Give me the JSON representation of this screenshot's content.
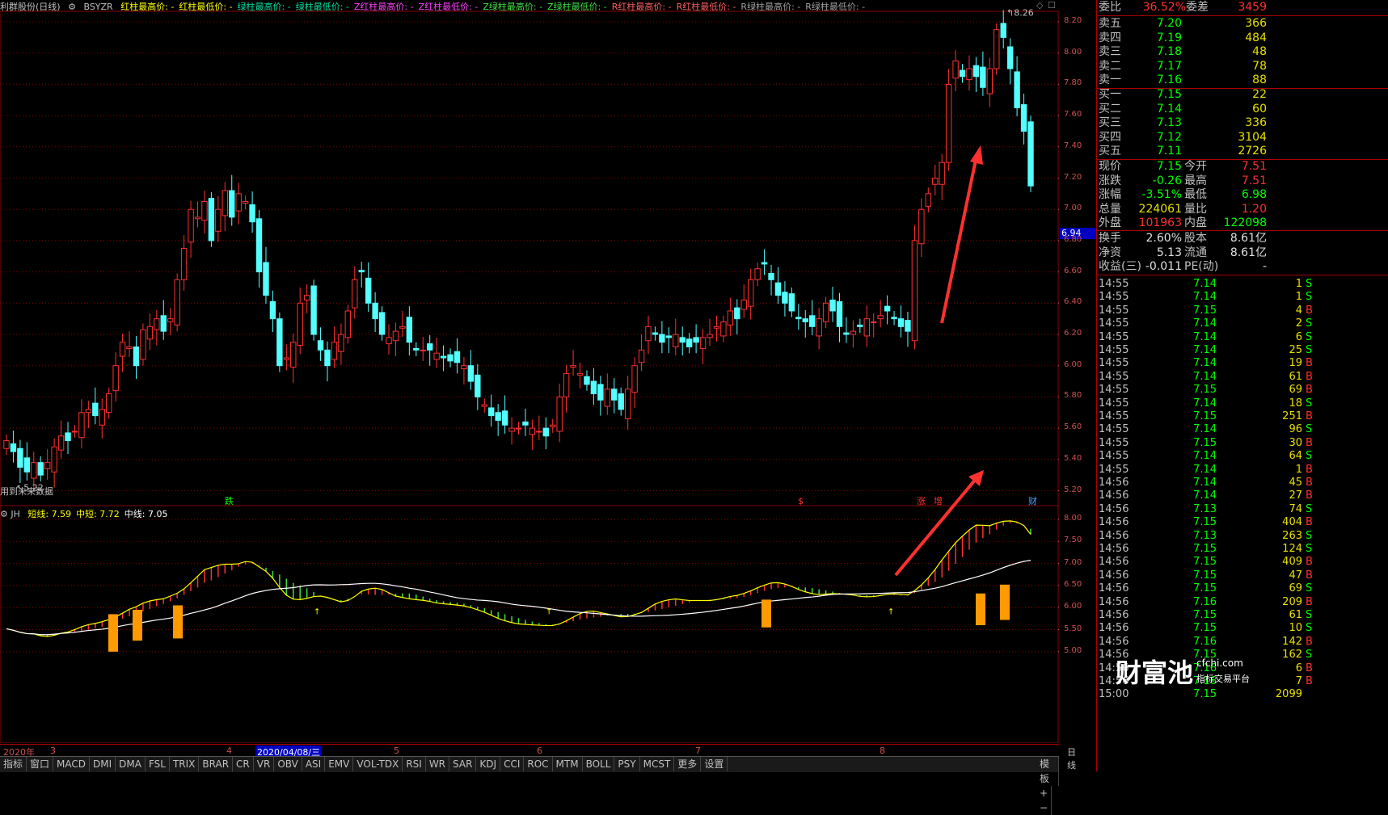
{
  "header": {
    "stock_name": "利群股份(日线)",
    "indicator": "BSYZR",
    "items": [
      {
        "label": "红柱最高价: -",
        "color": "#ffff00"
      },
      {
        "label": "红柱最低价: -",
        "color": "#ffff00"
      },
      {
        "label": "绿柱最高价: -",
        "color": "#00e0a0"
      },
      {
        "label": "绿柱最低价: -",
        "color": "#00e0a0"
      },
      {
        "label": "Z红柱最高价: -",
        "color": "#ff40ff"
      },
      {
        "label": "Z红柱最低价: -",
        "color": "#ff40ff"
      },
      {
        "label": "Z绿柱最高价: -",
        "color": "#40e040"
      },
      {
        "label": "Z绿柱最低价: -",
        "color": "#40e040"
      },
      {
        "label": "R红柱最高价: -",
        "color": "#ff6060"
      },
      {
        "label": "R红柱最低价: -",
        "color": "#ff6060"
      },
      {
        "label": "R绿柱最高价: -",
        "color": "#a0a0a0"
      },
      {
        "label": "R绿柱最低价: -",
        "color": "#a0a0a0"
      }
    ]
  },
  "colors": {
    "up": "#ff3030",
    "down": "#54ffff",
    "grid": "#8b0000",
    "accent_blue": "#0000c0"
  },
  "chart_data": [
    {
      "type": "candlestick",
      "title": "利群股份(日线)",
      "ylim": [
        5.1,
        8.3
      ],
      "yticks": [
        "8.20",
        "8.00",
        "7.80",
        "7.60",
        "7.40",
        "7.20",
        "7.00",
        "6.80",
        "6.60",
        "6.40",
        "6.20",
        "6.00",
        "5.80",
        "5.60",
        "5.40",
        "5.20"
      ],
      "current_price_tag": "6.94",
      "max_label": "8.26",
      "min_label": "5.22",
      "event_markers": [
        "跌",
        "$",
        "涨",
        "增",
        "财"
      ],
      "note_text": "用到未来数据"
    },
    {
      "type": "line",
      "title": "JH",
      "series": [
        {
          "name": "短线",
          "value": "7.59",
          "color": "#ffff00"
        },
        {
          "name": "中短",
          "value": "7.72",
          "color": "#ffff00"
        },
        {
          "name": "中线",
          "value": "7.05",
          "color": "#ffffff"
        }
      ],
      "ylim": [
        4.8,
        8.2
      ],
      "yticks": [
        "8.00",
        "7.50",
        "7.00",
        "6.50",
        "6.00",
        "5.50",
        "5.00"
      ]
    }
  ],
  "dates": {
    "labels": [
      "2020年",
      "3",
      "4",
      "2020/04/08/三",
      "5",
      "6",
      "7",
      "8"
    ],
    "right_label": "日线"
  },
  "tabs": [
    "指标",
    "窗口",
    "MACD",
    "DMI",
    "DMA",
    "FSL",
    "TRIX",
    "BRAR",
    "CR",
    "VR",
    "OBV",
    "ASI",
    "EMV",
    "VOL-TDX",
    "RSI",
    "WR",
    "SAR",
    "KDJ",
    "CCI",
    "ROC",
    "MTM",
    "BOLL",
    "PSY",
    "MCST",
    "更多",
    "设置"
  ],
  "right_tabs": [
    "模板",
    "+",
    "−"
  ],
  "order_book": {
    "weibi_label": "委比",
    "weibi": "36.52%",
    "weicha_label": "委差",
    "weicha": "3459",
    "sells": [
      {
        "label": "卖五",
        "price": "7.20",
        "vol": "366"
      },
      {
        "label": "卖四",
        "price": "7.19",
        "vol": "484"
      },
      {
        "label": "卖三",
        "price": "7.18",
        "vol": "48"
      },
      {
        "label": "卖二",
        "price": "7.17",
        "vol": "78"
      },
      {
        "label": "卖一",
        "price": "7.16",
        "vol": "88"
      }
    ],
    "buys": [
      {
        "label": "买一",
        "price": "7.15",
        "vol": "22"
      },
      {
        "label": "买二",
        "price": "7.14",
        "vol": "60"
      },
      {
        "label": "买三",
        "price": "7.13",
        "vol": "336"
      },
      {
        "label": "买四",
        "price": "7.12",
        "vol": "3104"
      },
      {
        "label": "买五",
        "price": "7.11",
        "vol": "2726"
      }
    ]
  },
  "stats": [
    {
      "l1": "现价",
      "v1": "7.15",
      "c1": "#00ff00",
      "l2": "今开",
      "v2": "7.51",
      "c2": "#ff3030"
    },
    {
      "l1": "涨跌",
      "v1": "-0.26",
      "c1": "#00ff00",
      "l2": "最高",
      "v2": "7.51",
      "c2": "#ff3030"
    },
    {
      "l1": "涨幅",
      "v1": "-3.51%",
      "c1": "#00ff00",
      "l2": "最低",
      "v2": "6.98",
      "c2": "#00ff00"
    },
    {
      "l1": "总量",
      "v1": "224061",
      "c1": "#e8e000",
      "l2": "量比",
      "v2": "1.20",
      "c2": "#ff3030"
    },
    {
      "l1": "外盘",
      "v1": "101963",
      "c1": "#ff3030",
      "l2": "内盘",
      "v2": "122098",
      "c2": "#00ff00"
    },
    {
      "l1": "换手",
      "v1": "2.60%",
      "c1": "#e0e0e0",
      "l2": "股本",
      "v2": "8.61亿",
      "c2": "#e0e0e0"
    },
    {
      "l1": "净资",
      "v1": "5.13",
      "c1": "#e0e0e0",
      "l2": "流通",
      "v2": "8.61亿",
      "c2": "#e0e0e0"
    },
    {
      "l1": "收益(三)",
      "v1": "-0.011",
      "c1": "#e0e0e0",
      "l2": "PE(动)",
      "v2": "-",
      "c2": "#e0e0e0"
    }
  ],
  "ticks": [
    {
      "t": "14:55",
      "p": "7.14",
      "v": "1",
      "s": "S"
    },
    {
      "t": "14:55",
      "p": "7.14",
      "v": "1",
      "s": "S"
    },
    {
      "t": "14:55",
      "p": "7.15",
      "v": "4",
      "s": "B"
    },
    {
      "t": "14:55",
      "p": "7.14",
      "v": "2",
      "s": "S"
    },
    {
      "t": "14:55",
      "p": "7.14",
      "v": "6",
      "s": "S"
    },
    {
      "t": "14:55",
      "p": "7.14",
      "v": "25",
      "s": "S"
    },
    {
      "t": "14:55",
      "p": "7.14",
      "v": "19",
      "s": "B"
    },
    {
      "t": "14:55",
      "p": "7.14",
      "v": "61",
      "s": "B"
    },
    {
      "t": "14:55",
      "p": "7.15",
      "v": "69",
      "s": "B"
    },
    {
      "t": "14:55",
      "p": "7.14",
      "v": "18",
      "s": "S"
    },
    {
      "t": "14:55",
      "p": "7.15",
      "v": "251",
      "s": "B"
    },
    {
      "t": "14:55",
      "p": "7.14",
      "v": "96",
      "s": "S"
    },
    {
      "t": "14:55",
      "p": "7.15",
      "v": "30",
      "s": "B"
    },
    {
      "t": "14:55",
      "p": "7.14",
      "v": "64",
      "s": "S"
    },
    {
      "t": "14:55",
      "p": "7.14",
      "v": "1",
      "s": "B"
    },
    {
      "t": "14:56",
      "p": "7.14",
      "v": "45",
      "s": "B"
    },
    {
      "t": "14:56",
      "p": "7.14",
      "v": "27",
      "s": "B"
    },
    {
      "t": "14:56",
      "p": "7.13",
      "v": "74",
      "s": "S"
    },
    {
      "t": "14:56",
      "p": "7.15",
      "v": "404",
      "s": "B"
    },
    {
      "t": "14:56",
      "p": "7.13",
      "v": "263",
      "s": "S"
    },
    {
      "t": "14:56",
      "p": "7.15",
      "v": "124",
      "s": "S"
    },
    {
      "t": "14:56",
      "p": "7.15",
      "v": "409",
      "s": "B"
    },
    {
      "t": "14:56",
      "p": "7.15",
      "v": "47",
      "s": "B"
    },
    {
      "t": "14:56",
      "p": "7.15",
      "v": "69",
      "s": "S"
    },
    {
      "t": "14:56",
      "p": "7.16",
      "v": "209",
      "s": "B"
    },
    {
      "t": "14:56",
      "p": "7.15",
      "v": "61",
      "s": "S"
    },
    {
      "t": "14:56",
      "p": "7.15",
      "v": "10",
      "s": "S"
    },
    {
      "t": "14:56",
      "p": "7.16",
      "v": "142",
      "s": "B"
    },
    {
      "t": "14:56",
      "p": "7.15",
      "v": "162",
      "s": "S"
    },
    {
      "t": "14:56",
      "p": "7.16",
      "v": "6",
      "s": "B"
    },
    {
      "t": "14:56",
      "p": "7.16",
      "v": "7",
      "s": "B"
    },
    {
      "t": "15:00",
      "p": "7.15",
      "v": "2099",
      "s": ""
    }
  ],
  "watermark": {
    "main": "财富池",
    "site": "cfchi.com",
    "sub": "指标交易平台"
  }
}
